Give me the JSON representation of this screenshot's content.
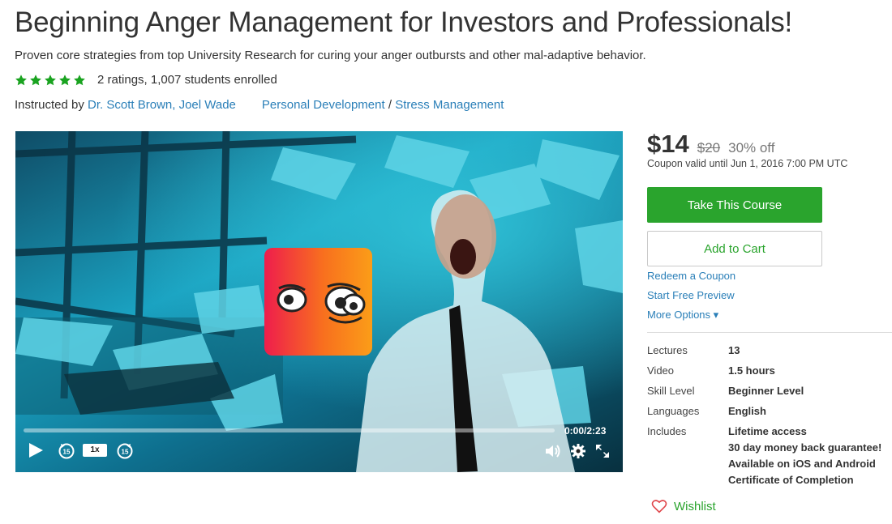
{
  "course": {
    "title": "Beginning Anger Management for Investors and Professionals!",
    "subtitle": "Proven core strategies from top University Research for curing your anger outbursts and other mal-adaptive behavior.",
    "rating_stars": 5,
    "rating_text": "2 ratings, 1,007 students enrolled",
    "instructed_prefix": "Instructed by ",
    "instructors": "Dr. Scott Brown, Joel Wade",
    "category": "Personal Development",
    "category_sep": " / ",
    "subcategory": "Stress Management"
  },
  "player": {
    "time": "0:00/2:23",
    "speed": "1x",
    "progress_fraction": 0,
    "icons": [
      "play-icon",
      "rewind-15-icon",
      "forward-15-icon",
      "volume-icon",
      "settings-gear-icon",
      "fullscreen-icon"
    ]
  },
  "pricing": {
    "price": "$14",
    "original": "$20",
    "discount": "30% off",
    "coupon_note": "Coupon valid until Jun 1, 2016 7:00 PM UTC",
    "take_course": "Take This Course",
    "add_to_cart": "Add to Cart",
    "redeem": "Redeem a Coupon",
    "preview": "Start Free Preview",
    "more_options": "More Options ▾"
  },
  "details": [
    {
      "label": "Lectures",
      "value": "13"
    },
    {
      "label": "Video",
      "value": "1.5 hours"
    },
    {
      "label": "Skill Level",
      "value": "Beginner Level"
    },
    {
      "label": "Languages",
      "value": "English"
    }
  ],
  "includes": {
    "label": "Includes",
    "items": [
      "Lifetime access",
      "30 day money back guarantee!",
      "Available on iOS and Android",
      "Certificate of Completion"
    ]
  },
  "wishlist": "Wishlist",
  "colors": {
    "accent_green": "#2aa42d",
    "link_blue": "#2a7fb8",
    "star_green": "#1aa320"
  }
}
